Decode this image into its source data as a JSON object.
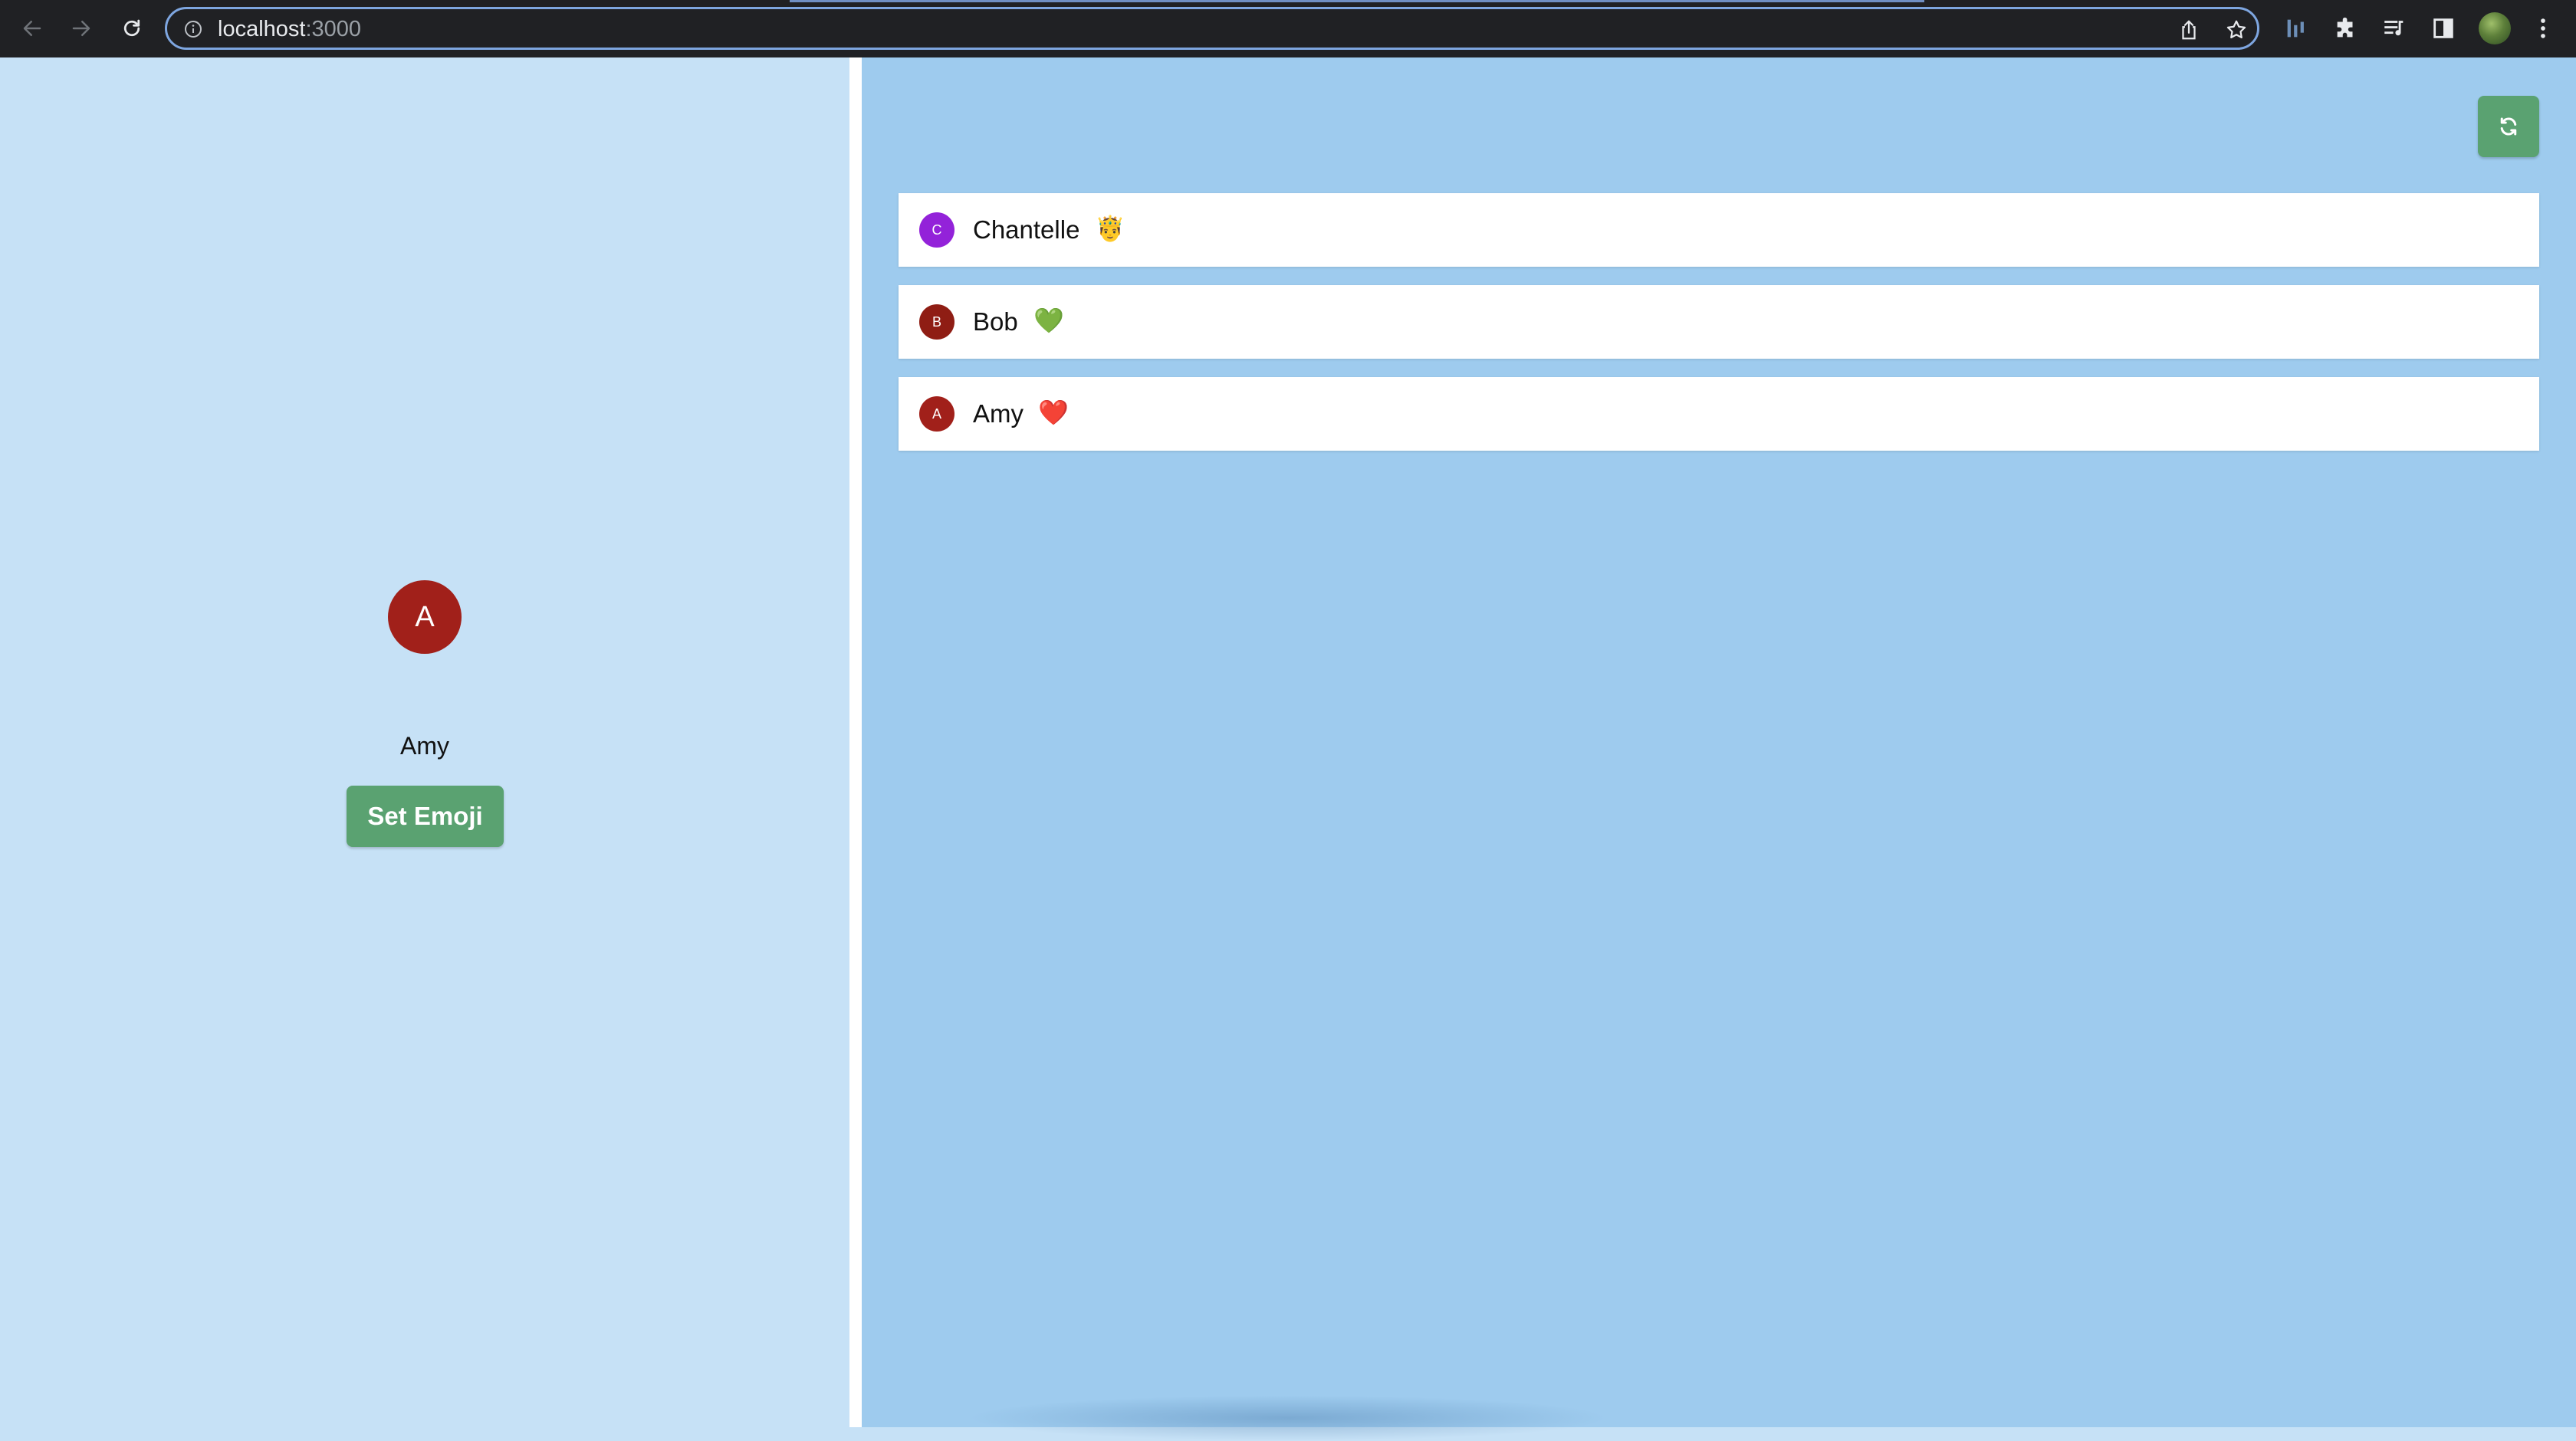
{
  "browser": {
    "url_host": "localhost",
    "url_port": ":3000",
    "icons": [
      "back-arrow-icon",
      "forward-arrow-icon",
      "reload-icon",
      "info-icon",
      "share-icon",
      "bookmark-star-icon",
      "extension-bars-icon",
      "puzzle-extensions-icon",
      "media-queue-icon",
      "side-panel-icon",
      "profile-avatar",
      "kebab-menu-icon"
    ]
  },
  "profile": {
    "initial": "A",
    "name": "Amy",
    "avatar_color": "#a1201a",
    "set_emoji_label": "Set Emoji"
  },
  "refresh": {
    "icon": "refresh-icon"
  },
  "users": [
    {
      "initial": "C",
      "name": "Chantelle",
      "emoji": "🤴",
      "avatar_color": "#9322d9"
    },
    {
      "initial": "B",
      "name": "Bob",
      "emoji": "💚",
      "avatar_color": "#8f1d14"
    },
    {
      "initial": "A",
      "name": "Amy",
      "emoji": "❤️",
      "avatar_color": "#a1201a"
    }
  ],
  "colors": {
    "left_panel_bg": "#c6e1f6",
    "right_panel_bg": "#9ecbee",
    "accent_green": "#5aa271"
  }
}
